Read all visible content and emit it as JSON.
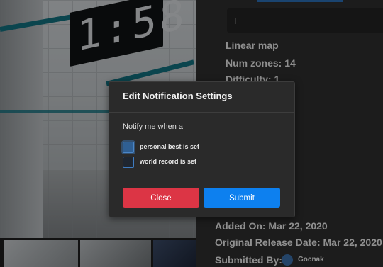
{
  "modal": {
    "title": "Edit Notification Settings",
    "prompt": "Notify me when a",
    "options": [
      {
        "label": "personal best is set",
        "checked": false,
        "focused": true
      },
      {
        "label": "world record is set",
        "checked": false,
        "focused": false
      }
    ],
    "close_label": "Close",
    "submit_label": "Submit"
  },
  "map_info": {
    "input_value": "I",
    "lines": [
      "Linear map",
      "Num zones: 14",
      "Difficulty: 1"
    ]
  },
  "details": {
    "added_on": "Added On: Mar 22, 2020",
    "original_release": "Original Release Date: Mar 22, 2020",
    "submitted_by_label": "Submitted By:",
    "submitter": "Gocnak"
  },
  "game_image": {
    "clock_text": "1:58"
  },
  "colors": {
    "accent_blue": "#0d80ef",
    "danger_red": "#dc3545",
    "modal_bg": "#2a2a2a",
    "teal_stripe": "#13707f"
  }
}
